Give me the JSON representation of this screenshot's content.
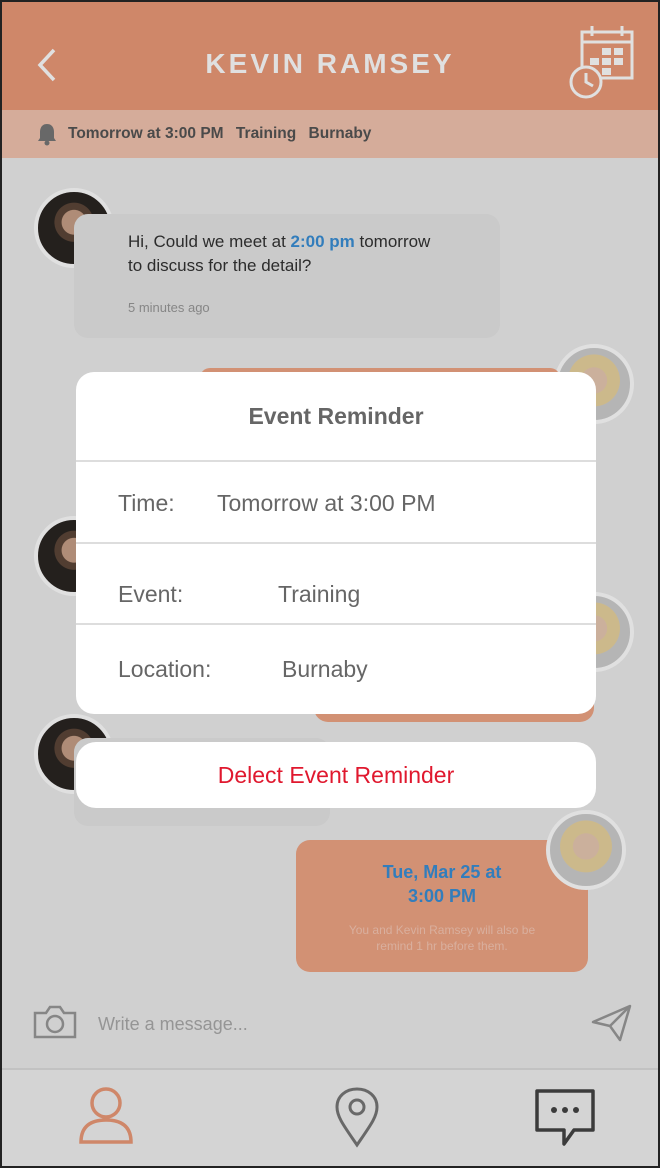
{
  "header": {
    "title": "KEVIN RAMSEY",
    "back_icon": "chevron-left-icon",
    "calendar_icon": "calendar-clock-icon"
  },
  "banner": {
    "time": "Tomorrow at 3:00 PM",
    "event": "Training",
    "location": "Burnaby"
  },
  "messages": [
    {
      "line1_prefix": "Hi,  Could we meet at ",
      "line1_highlight": "2:00 pm",
      "line1_suffix": " tomorrow",
      "line2": "to discuss for the detail?",
      "time": "5 minutes ago"
    }
  ],
  "event_card": {
    "date": "Tue, Mar 25 at",
    "time": "3:00 PM",
    "note_line1": "You and Kevin Ramsey will also be",
    "note_line2": "remind 1 hr before them."
  },
  "composer": {
    "placeholder": "Write a message..."
  },
  "modal": {
    "title": "Event Reminder",
    "rows": [
      {
        "label": "Time:",
        "value": "Tomorrow at 3:00 PM"
      },
      {
        "label": "Event:",
        "value": "Training"
      },
      {
        "label": "Location:",
        "value": "Burnaby"
      }
    ],
    "delete_label": "Delect Event Reminder"
  },
  "colors": {
    "accent": "#ec9a78",
    "highlight": "#3a8fd6",
    "danger": "#e0182e"
  }
}
